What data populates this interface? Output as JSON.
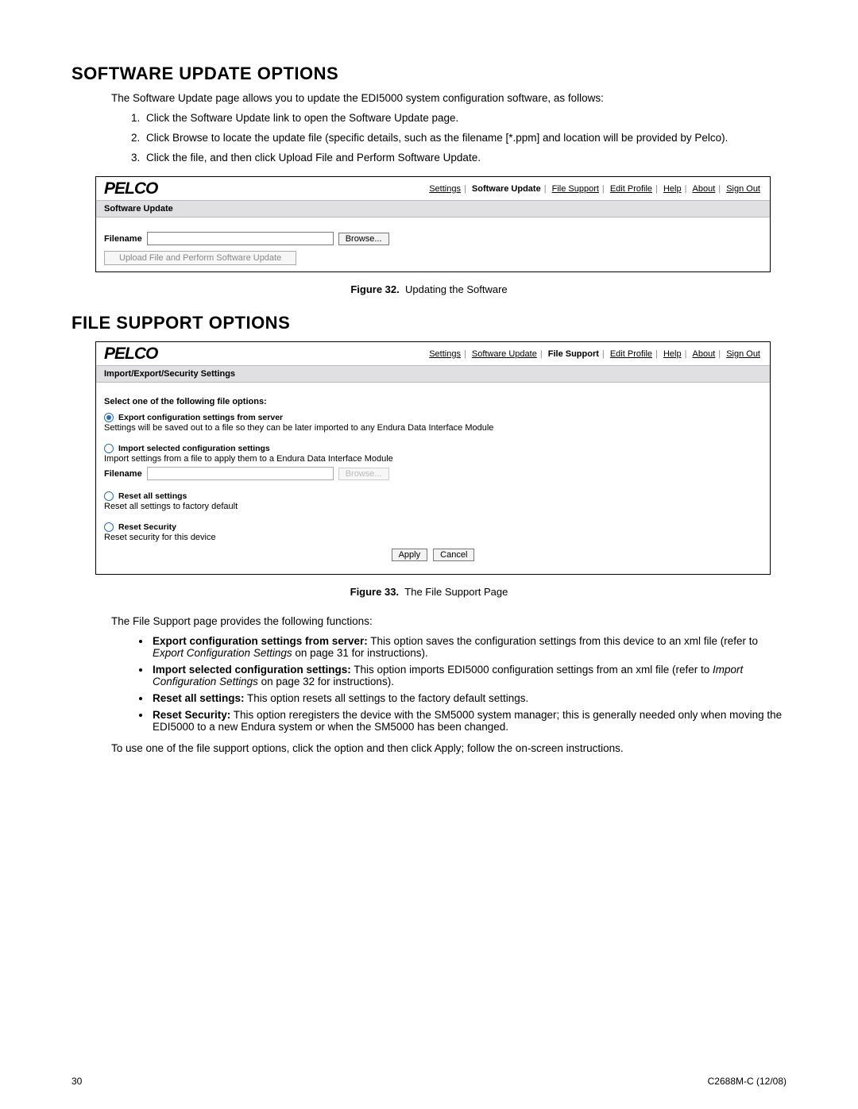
{
  "section1": {
    "heading": "Software Update Options",
    "intro": "The Software Update page allows you to update the EDI5000 system configuration software, as follows:",
    "steps": [
      "Click the Software Update link to open the Software Update page.",
      "Click Browse to locate the update file (specific details, such as the filename [*.ppm] and location will be provided by Pelco).",
      "Click the file, and then click Upload File and Perform Software Update."
    ]
  },
  "fig1": {
    "logo": "PELCO",
    "nav": {
      "settings": "Settings",
      "software_update": "Software Update",
      "file_support": "File Support",
      "edit_profile": "Edit Profile",
      "help": "Help",
      "about": "About",
      "sign_out": "Sign Out"
    },
    "bar": "Software Update",
    "filename_label": "Filename",
    "browse": "Browse...",
    "upload": "Upload File and Perform Software Update",
    "caption_label": "Figure 32.",
    "caption_text": "Updating the Software"
  },
  "section2": {
    "heading": "File Support Options"
  },
  "fig2": {
    "logo": "PELCO",
    "nav": {
      "settings": "Settings",
      "software_update": "Software Update",
      "file_support": "File Support",
      "edit_profile": "Edit Profile",
      "help": "Help",
      "about": "About",
      "sign_out": "Sign Out"
    },
    "bar": "Import/Export/Security Settings",
    "select_label": "Select one of the following file options:",
    "opt1_title": "Export configuration settings from server",
    "opt1_desc": "Settings will be saved out to a file so they can be later imported to any Endura Data Interface Module",
    "opt2_title": "Import selected configuration settings",
    "opt2_desc": "Import settings from a file to apply them to a Endura Data Interface Module",
    "filename_label": "Filename",
    "browse": "Browse...",
    "opt3_title": "Reset all settings",
    "opt3_desc": "Reset all settings to factory default",
    "opt4_title": "Reset Security",
    "opt4_desc": "Reset security for this device",
    "apply": "Apply",
    "cancel": "Cancel",
    "caption_label": "Figure 33.",
    "caption_text": "The File Support Page"
  },
  "desc": {
    "intro": "The File Support page provides the following functions:",
    "b1_bold": "Export configuration settings from server:",
    "b1_text": "  This option saves the configuration settings from this device to an xml file (refer to ",
    "b1_em": "Export Configuration Settings",
    "b1_tail": " on page 31 for instructions).",
    "b2_bold": "Import selected configuration settings:",
    "b2_text": "  This option imports EDI5000 configuration settings from an xml file (refer to ",
    "b2_em": "Import Configuration Settings",
    "b2_tail": " on page 32 for instructions).",
    "b3_bold": "Reset all settings:",
    "b3_text": "  This option resets all settings to the factory default settings.",
    "b4_bold": "Reset Security:",
    "b4_text": "  This option reregisters the device with the SM5000 system manager; this is generally needed only when moving the EDI5000 to a new Endura system or when the SM5000 has been changed.",
    "closing": "To use one of the file support options, click the option and then click Apply; follow the on-screen instructions."
  },
  "footer": {
    "page": "30",
    "doc": "C2688M-C (12/08)"
  }
}
